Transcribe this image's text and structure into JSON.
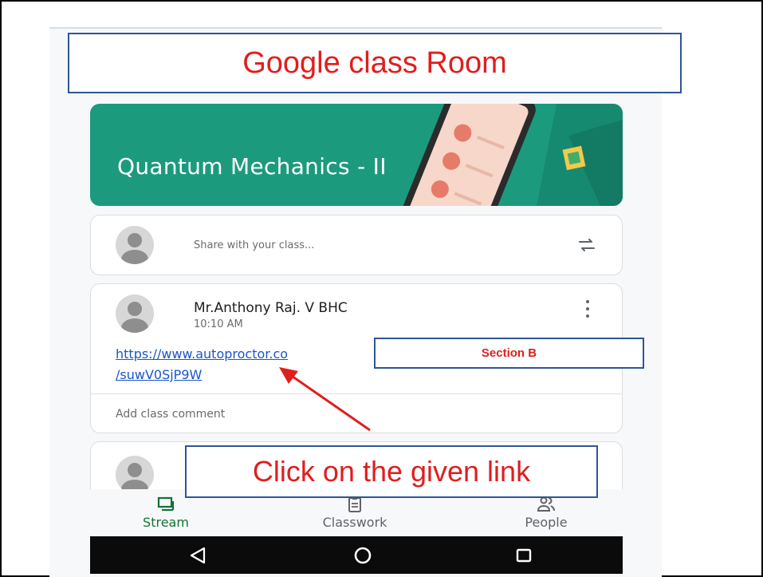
{
  "slide": {
    "title": "Google class  Room",
    "section_callout": "Section B",
    "instruction_callout": "Click on the given link"
  },
  "classroom": {
    "class_name": "Quantum Mechanics - II",
    "share_placeholder": "Share with your class...",
    "post": {
      "author": "Mr.Anthony Raj. V BHC",
      "time": "10:10 AM",
      "link_line1": "https://www.autoproctor.co",
      "link_line2": "/suwV0SjP9W",
      "comment_placeholder": "Add class comment"
    }
  },
  "bottom_nav": {
    "items": [
      {
        "label": "Stream",
        "icon": "stream-icon",
        "active": true
      },
      {
        "label": "Classwork",
        "icon": "classwork-icon",
        "active": false
      },
      {
        "label": "People",
        "icon": "people-icon",
        "active": false
      }
    ]
  },
  "system_nav": {
    "icons": [
      "back-icon",
      "home-icon",
      "recents-icon"
    ]
  },
  "colors": {
    "banner": "#1b9a7e",
    "callout_text": "#e01e1e",
    "callout_border": "#2f5597",
    "link": "#1a56c9",
    "active_nav": "#137333"
  }
}
